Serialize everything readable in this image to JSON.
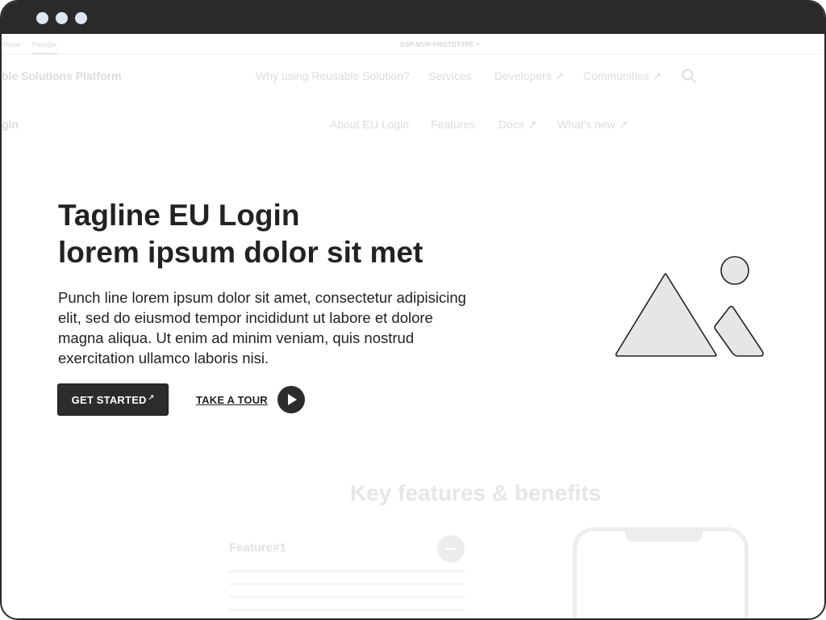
{
  "tabstrip": {
    "tab_home": "Home",
    "tab_partager": "Partager",
    "prototype_label": "RSP-MVP-PROTOTYPE ˅"
  },
  "main_nav": {
    "brand": "ble Solutions Platform",
    "links": [
      "Why using Reusable Solution?",
      "Services",
      "Developers ↗",
      "Communities ↗"
    ],
    "search_icon": "search-icon"
  },
  "sub_nav": {
    "brand": "gin",
    "links": [
      "About EU Login",
      "Features",
      "Docs ↗",
      "What's new ↗"
    ]
  },
  "hero": {
    "title_line1": "Tagline EU Login",
    "title_line2": "lorem ipsum dolor sit met",
    "text": "Punch line lorem ipsum dolor sit amet, consectetur adipisicing elit, sed do eiusmod tempor incididunt ut labore et dolore magna aliqua. Ut enim ad minim veniam, quis nostrud exercitation ullamco laboris nisi.",
    "get_started": "GET STARTED",
    "get_started_arrow": "↗",
    "take_tour": "TAKE A TOUR",
    "image_icon": "image-placeholder-icon"
  },
  "features": {
    "title": "Key features & benefits",
    "feature1": "Feature#1"
  },
  "colors": {
    "dark": "#2c2c2c",
    "faded_text": "#dcdcdc",
    "titlebar": "#2a2a2a"
  }
}
